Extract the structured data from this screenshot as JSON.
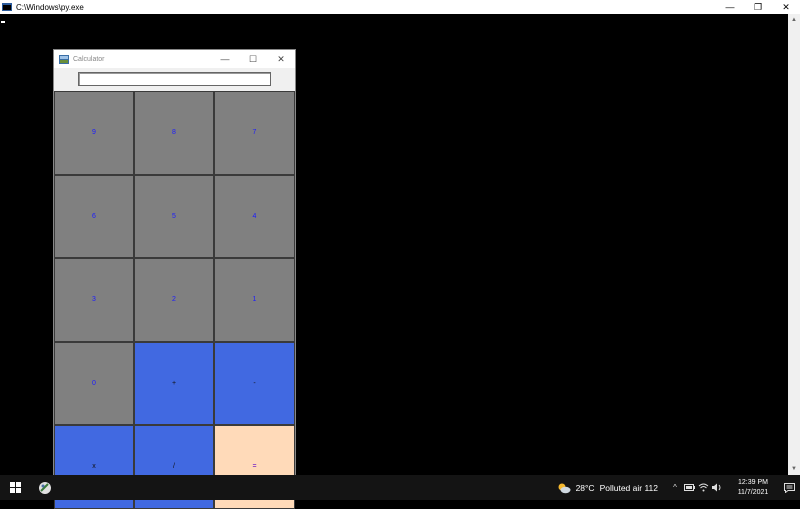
{
  "console": {
    "title": "C:\\Windows\\py.exe",
    "minimize_glyph": "—",
    "restore_glyph": "❐",
    "close_glyph": "✕"
  },
  "calculator": {
    "title": "Calculator",
    "minimize_glyph": "—",
    "maximize_glyph": "☐",
    "close_glyph": "✕",
    "display_value": "",
    "keys": [
      {
        "label": "9",
        "bg": "#808080",
        "fg": "#1a1aff"
      },
      {
        "label": "8",
        "bg": "#808080",
        "fg": "#1a1aff"
      },
      {
        "label": "7",
        "bg": "#808080",
        "fg": "#1a1aff"
      },
      {
        "label": "6",
        "bg": "#808080",
        "fg": "#1a1aff"
      },
      {
        "label": "5",
        "bg": "#808080",
        "fg": "#1a1aff"
      },
      {
        "label": "4",
        "bg": "#808080",
        "fg": "#1a1aff"
      },
      {
        "label": "3",
        "bg": "#808080",
        "fg": "#1a1aff"
      },
      {
        "label": "2",
        "bg": "#808080",
        "fg": "#1a1aff"
      },
      {
        "label": "1",
        "bg": "#808080",
        "fg": "#1a1aff"
      },
      {
        "label": "0",
        "bg": "#808080",
        "fg": "#1a1aff"
      },
      {
        "label": "+",
        "bg": "#4169e1",
        "fg": "#111111"
      },
      {
        "label": "-",
        "bg": "#4169e1",
        "fg": "#111111"
      },
      {
        "label": "x",
        "bg": "#4169e1",
        "fg": "#111111"
      },
      {
        "label": "/",
        "bg": "#4169e1",
        "fg": "#111111"
      },
      {
        "label": "=",
        "bg": "#ffdab9",
        "fg": "#5a00c8"
      }
    ]
  },
  "taskbar": {
    "start_icon": "windows-logo-icon",
    "python_icon": "python-app-icon",
    "weather": {
      "temp": "28°C",
      "condition": "Polluted air 112"
    },
    "tray_glyphs": {
      "chevron": "^",
      "volume": "🔊"
    },
    "clock": {
      "time": "12:39 PM",
      "date": "11/7/2021"
    }
  }
}
